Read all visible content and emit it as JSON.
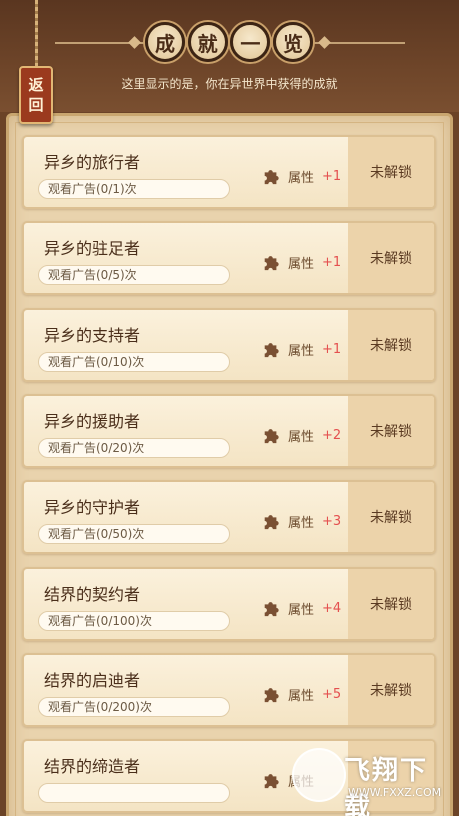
{
  "header": {
    "title_chars": [
      "成",
      "就",
      "一",
      "览"
    ],
    "subtitle": "这里显示的是，你在异世界中获得的成就"
  },
  "back_button": {
    "chars": [
      "返",
      "回"
    ]
  },
  "attribute_label": "属性",
  "achievements": [
    {
      "name": "异乡的旅行者",
      "progress": "观看广告(0/1)次",
      "bonus": "+1",
      "status": "未解锁"
    },
    {
      "name": "异乡的驻足者",
      "progress": "观看广告(0/5)次",
      "bonus": "+1",
      "status": "未解锁"
    },
    {
      "name": "异乡的支持者",
      "progress": "观看广告(0/10)次",
      "bonus": "+1",
      "status": "未解锁"
    },
    {
      "name": "异乡的援助者",
      "progress": "观看广告(0/20)次",
      "bonus": "+2",
      "status": "未解锁"
    },
    {
      "name": "异乡的守护者",
      "progress": "观看广告(0/50)次",
      "bonus": "+3",
      "status": "未解锁"
    },
    {
      "name": "结界的契约者",
      "progress": "观看广告(0/100)次",
      "bonus": "+4",
      "status": "未解锁"
    },
    {
      "name": "结界的启迪者",
      "progress": "观看广告(0/200)次",
      "bonus": "+5",
      "status": "未解锁"
    },
    {
      "name": "结界的缔造者",
      "progress": "",
      "bonus": "",
      "status": ""
    }
  ],
  "watermark": {
    "brand": "飞翔下载",
    "url": "WWW.FXXZ.COM"
  },
  "colors": {
    "bonus": "#e4504f",
    "back_button": "#9b3a1e",
    "header_bg": "#6b4327"
  }
}
